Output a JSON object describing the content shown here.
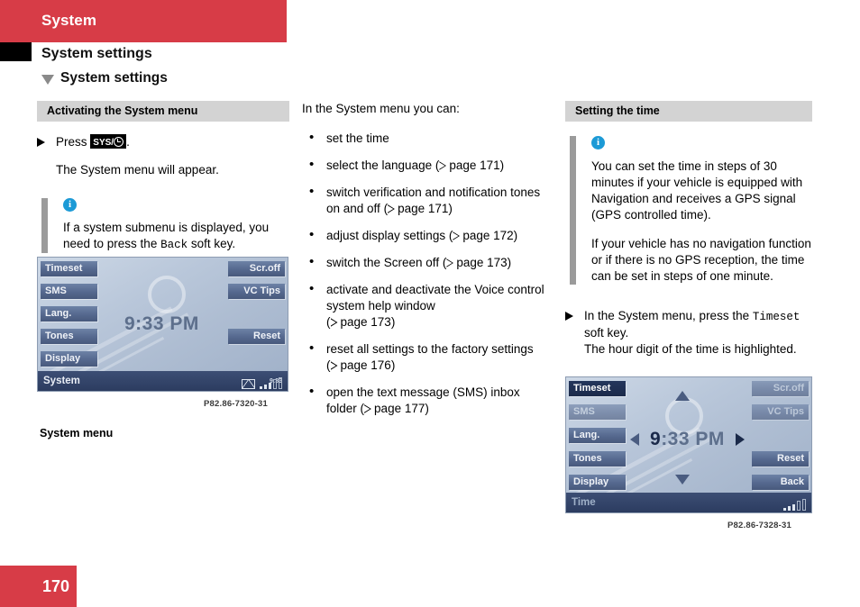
{
  "header": {
    "chapter": "System",
    "section": "System settings",
    "subsection": "System settings"
  },
  "left_column": {
    "section_bar": "Activating the System menu",
    "step_press_prefix": "Press",
    "step_press_badge": "SYS/",
    "step_press_suffix": ".",
    "step_result": "The System menu will appear.",
    "note_icon": "i",
    "note_text_a": "If a system submenu is displayed, you need to press the ",
    "note_key": "Back",
    "note_text_b": " soft key.",
    "figure": {
      "left_keys": [
        "Timeset",
        "SMS",
        "Lang.",
        "Tones",
        "Display"
      ],
      "right_keys": [
        "Scr.off",
        "VC Tips",
        "Reset"
      ],
      "clock": "9:33 PM",
      "status_label": "System",
      "status_time": "9:33",
      "image_code": "P82.86-7320-31"
    },
    "caption": "System menu"
  },
  "middle_column": {
    "intro": "In the System menu you can:",
    "bullets": [
      {
        "text": "set the time",
        "ref": ""
      },
      {
        "text": "select the language",
        "ref": "page 171"
      },
      {
        "text": "switch verification and notification tones on and off",
        "ref": "page 171"
      },
      {
        "text": "adjust display settings",
        "ref": "page 172"
      },
      {
        "text": "switch the Screen off",
        "ref": "page 173"
      },
      {
        "text": "activate and deactivate the Voice control system help window",
        "ref": "page 173"
      },
      {
        "text": "reset all settings to the factory settings",
        "ref": "page 176"
      },
      {
        "text": "open the text message (SMS) inbox folder",
        "ref": "page 177"
      }
    ]
  },
  "right_column": {
    "section_bar": "Setting the time",
    "note_icon": "i",
    "note_p1": "You can set the time in steps of 30 minutes if your vehicle is equipped with Navigation and receives a GPS signal (GPS controlled time).",
    "note_p2": "If your vehicle has no navigation function or if there is no GPS reception, the time can be set in steps of one minute.",
    "step_prefix": "In the System menu, press the ",
    "step_key": "Timeset",
    "step_suffix": " soft key.",
    "step_result": "The hour digit of the time is highlighted.",
    "figure": {
      "left_keys": [
        "Timeset",
        "SMS",
        "Lang.",
        "Tones",
        "Display"
      ],
      "right_keys": [
        "Scr.off",
        "VC Tips",
        "Reset",
        "Back"
      ],
      "clock_hour": "9",
      "clock_rest": ":33 PM",
      "status_label": "Time",
      "image_code": "P82.86-7328-31"
    }
  },
  "footer": {
    "page_number": "170"
  },
  "colors": {
    "brand_red": "#d73c47",
    "section_bar_gray": "#d3d3d3",
    "note_rule_gray": "#9b9b9b",
    "info_blue": "#1c9ad6"
  }
}
